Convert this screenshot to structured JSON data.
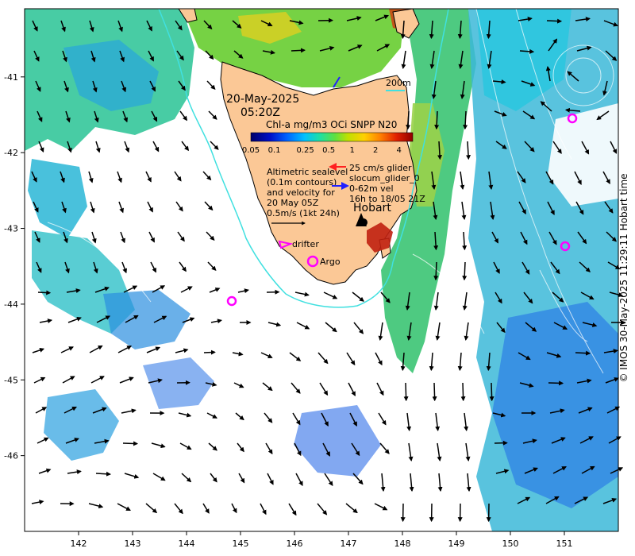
{
  "map": {
    "datetime_line1": "20-May-2025",
    "datetime_line2": "05:20Z",
    "colorbar": {
      "title": "Chl-a mg/m3 OCi SNPP N20",
      "ticks": [
        "0.05",
        "0.1",
        "0.25",
        "0.5",
        "1",
        "2",
        "4"
      ]
    },
    "isobath_label": "200m",
    "altimetry_note": [
      "Altimetric sealevel",
      "(0.1m contours)",
      "and velocity for",
      "20 May 05Z",
      "0.5m/s (1kt 24h)"
    ],
    "glider_note": [
      "25 cm/s glider",
      "slocum_glider_0",
      "0-62m vel",
      "16h to 18/05 21Z"
    ],
    "city_label": "Hobart",
    "drifter_label": "drifter",
    "argo_label": "Argo",
    "x_ticks": [
      "142",
      "143",
      "144",
      "145",
      "146",
      "147",
      "148",
      "149",
      "150",
      "151"
    ],
    "y_ticks": [
      "-41",
      "-42",
      "-43",
      "-44",
      "-45",
      "-46"
    ],
    "copyright": "© IMOS 30-May-2025 11:29:11 Hobart time"
  },
  "colors": {
    "land": "#fbc896",
    "isobath": "#40e0e0",
    "glider": "#ff2020",
    "glider_alt": "#2020ff",
    "markers": "#ff00ff",
    "colorbar": [
      "#00006a",
      "#0010c8",
      "#0060ff",
      "#00c0ff",
      "#20e0a0",
      "#60e040",
      "#c0e000",
      "#ffd000",
      "#ff8000",
      "#e02000",
      "#900000"
    ]
  },
  "chart_data": {
    "type": "map",
    "lon_range": [
      141,
      152
    ],
    "lat_range": [
      -47,
      -40.1
    ],
    "lon_ticks": [
      142,
      143,
      144,
      145,
      146,
      147,
      148,
      149,
      150,
      151
    ],
    "lat_ticks": [
      -41,
      -42,
      -43,
      -44,
      -45,
      -46
    ],
    "colorbar_scale": "log",
    "colorbar_range": [
      0.05,
      6
    ],
    "places": [
      {
        "name": "Hobart",
        "lon": 147.3,
        "lat": -42.9
      }
    ],
    "argo_floats": [
      {
        "lon": 146.3,
        "lat": -43.4
      },
      {
        "lon": 144.8,
        "lat": -43.9
      },
      {
        "lon": 151.1,
        "lat": -41.5
      },
      {
        "lon": 151.0,
        "lat": -43.2
      }
    ],
    "drifter": {
      "lon": 145.8,
      "lat": -43.1
    }
  }
}
